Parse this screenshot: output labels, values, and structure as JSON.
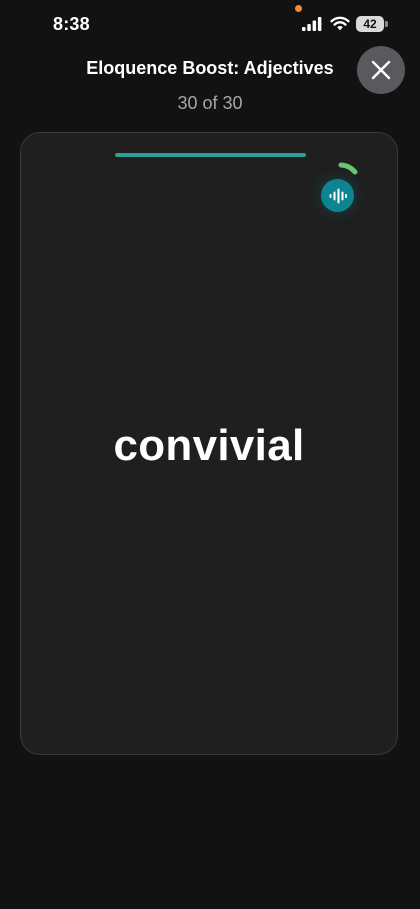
{
  "status_bar": {
    "time": "8:38",
    "battery_level": "42",
    "icons": [
      "signal-icon",
      "wifi-icon",
      "battery-icon"
    ],
    "privacy_dot_color": "#f0883e"
  },
  "header": {
    "title": "Eloquence Boost: Adjectives",
    "counter": "30 of 30",
    "close_icon": "close-icon"
  },
  "card": {
    "word": "convivial",
    "progress_fraction": 1.0,
    "progress_color": "#2aa198",
    "audio_icon": "sound-wave-icon",
    "audio_button_color": "#0c8590",
    "timer_ring_color": "#6cc46c"
  }
}
